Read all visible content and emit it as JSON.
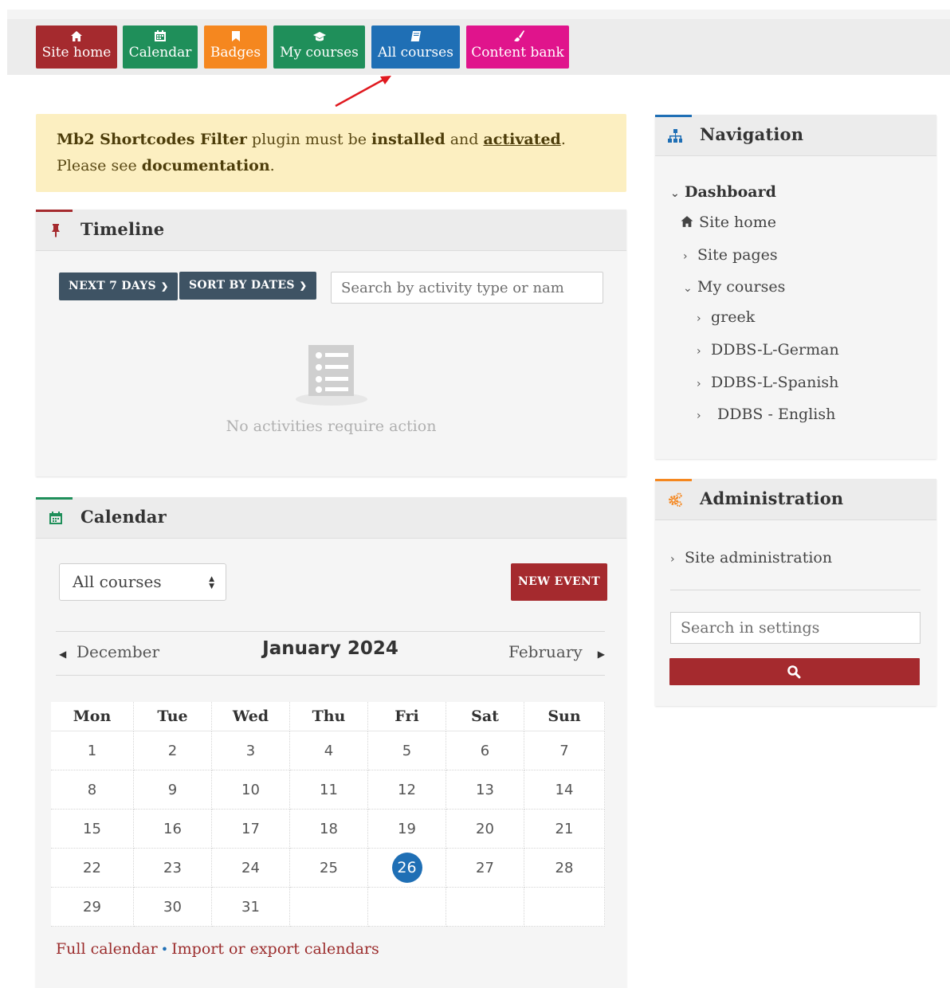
{
  "topnav": {
    "items": [
      {
        "label": "Site home",
        "icon": "home-icon",
        "color": "#a52a2e"
      },
      {
        "label": "Calendar",
        "icon": "calendar-icon",
        "color": "#1f8f5a"
      },
      {
        "label": "Badges",
        "icon": "bookmark-icon",
        "color": "#f5871f"
      },
      {
        "label": "My courses",
        "icon": "graduation-cap-icon",
        "color": "#1f8f5a"
      },
      {
        "label": "All courses",
        "icon": "book-icon",
        "color": "#1f6fb5"
      },
      {
        "label": "Content bank",
        "icon": "paint-brush-icon",
        "color": "#e0148c"
      }
    ]
  },
  "alert": {
    "plugin_name": "Mb2 Shortcodes Filter",
    "text_1": " plugin must be ",
    "installed": "installed",
    "text_2": " and ",
    "activated": "activated",
    "text_3": ". Please see ",
    "documentation": "documentation",
    "text_4": "."
  },
  "timeline": {
    "title": "Timeline",
    "accent_color": "#a52a2e",
    "filter_label": "NEXT 7 DAYS",
    "sort_label": "SORT BY DATES",
    "search_placeholder": "Search by activity type or nam",
    "empty_text": "No activities require action"
  },
  "calendar": {
    "title": "Calendar",
    "accent_color": "#1f8f5a",
    "course_select": "All courses",
    "new_event_label": "NEW EVENT",
    "prev_month": "December",
    "current_month": "January 2024",
    "next_month": "February",
    "weekdays": [
      "Mon",
      "Tue",
      "Wed",
      "Thu",
      "Fri",
      "Sat",
      "Sun"
    ],
    "weeks": [
      [
        "1",
        "2",
        "3",
        "4",
        "5",
        "6",
        "7"
      ],
      [
        "8",
        "9",
        "10",
        "11",
        "12",
        "13",
        "14"
      ],
      [
        "15",
        "16",
        "17",
        "18",
        "19",
        "20",
        "21"
      ],
      [
        "22",
        "23",
        "24",
        "25",
        "26",
        "27",
        "28"
      ],
      [
        "29",
        "30",
        "31",
        "",
        "",
        "",
        ""
      ]
    ],
    "today": "26",
    "today_color": "#1f6fb5",
    "full_calendar_link": "Full calendar",
    "link_separator": "•",
    "import_export_link": "Import or export calendars"
  },
  "navigation": {
    "title": "Navigation",
    "accent_color": "#1f6fb5",
    "dashboard": "Dashboard",
    "site_home": "Site home",
    "site_pages": "Site pages",
    "my_courses": "My courses",
    "courses": [
      "greek",
      "DDBS-L-German",
      "DDBS-L-Spanish",
      "DDBS - English"
    ]
  },
  "administration": {
    "title": "Administration",
    "accent_color": "#f5871f",
    "site_admin": "Site administration",
    "search_placeholder": "Search in settings"
  }
}
